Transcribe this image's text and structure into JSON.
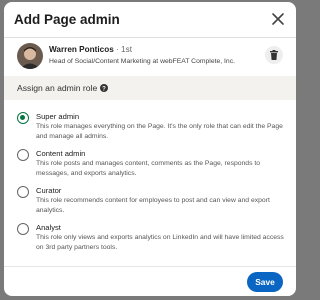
{
  "modal": {
    "title": "Add Page admin",
    "close_icon": "close-icon"
  },
  "user": {
    "name": "Warren Ponticos",
    "degree": " · 1st",
    "headline": "Head of Social/Content Marketing at webFEAT Complete, Inc.",
    "remove_icon": "trash-icon"
  },
  "roles": {
    "heading": "Assign an admin role",
    "help_icon": "help-icon",
    "options": [
      {
        "title": "Super admin",
        "description": "This role manages everything on the Page. It's the only role that can edit the Page and manage all admins.",
        "selected": true
      },
      {
        "title": "Content admin",
        "description": "This role posts and manages content, comments as the Page, responds to messages, and exports analytics.",
        "selected": false
      },
      {
        "title": "Curator",
        "description": "This role recommends content for employees to post and can view and export analytics.",
        "selected": false
      },
      {
        "title": "Analyst",
        "description": "This role only views and exports analytics on LinkedIn and will have limited access on 3rd party partners tools.",
        "selected": false
      }
    ]
  },
  "footer": {
    "save_label": "Save"
  },
  "colors": {
    "accent": "#0a66c2",
    "selected_radio": "#057642",
    "overlay": "#7a7a7a"
  }
}
